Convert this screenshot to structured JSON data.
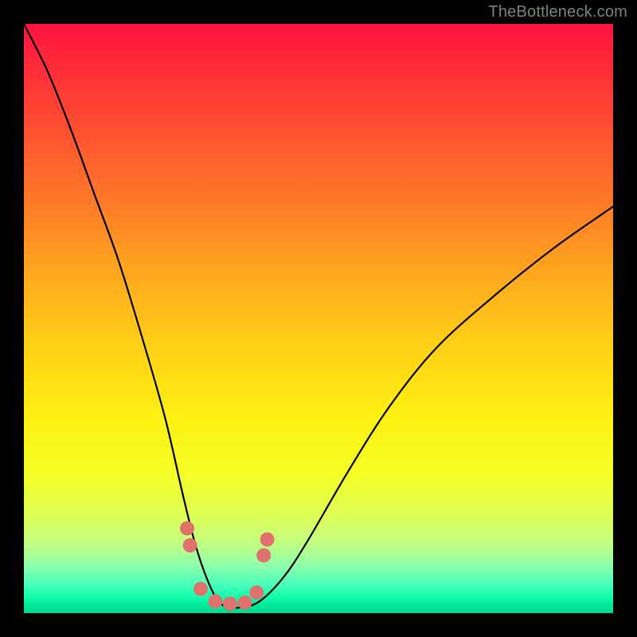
{
  "watermark": "TheBottleneck.com",
  "chart_data": {
    "type": "line",
    "title": "",
    "xlabel": "",
    "ylabel": "",
    "xlim": [
      0,
      1
    ],
    "ylim": [
      0,
      1
    ],
    "series": [
      {
        "name": "bottleneck-curve",
        "x": [
          0.0,
          0.04,
          0.08,
          0.12,
          0.16,
          0.2,
          0.24,
          0.27,
          0.29,
          0.31,
          0.33,
          0.35,
          0.37,
          0.4,
          0.44,
          0.48,
          0.55,
          0.62,
          0.7,
          0.8,
          0.9,
          1.0
        ],
        "values": [
          1.0,
          0.92,
          0.82,
          0.71,
          0.6,
          0.47,
          0.33,
          0.2,
          0.12,
          0.06,
          0.02,
          0.01,
          0.01,
          0.02,
          0.06,
          0.12,
          0.24,
          0.35,
          0.45,
          0.54,
          0.62,
          0.69
        ]
      }
    ],
    "markers": {
      "x": [
        0.277,
        0.282,
        0.3,
        0.325,
        0.35,
        0.375,
        0.395,
        0.407,
        0.413
      ],
      "values": [
        0.144,
        0.115,
        0.041,
        0.02,
        0.016,
        0.018,
        0.035,
        0.098,
        0.125
      ]
    },
    "gradient_bands": {
      "colors_top_to_bottom": [
        "#ff123f",
        "#ffef12",
        "#00d890"
      ],
      "meaning": "red=high bottleneck, green=no bottleneck"
    }
  }
}
